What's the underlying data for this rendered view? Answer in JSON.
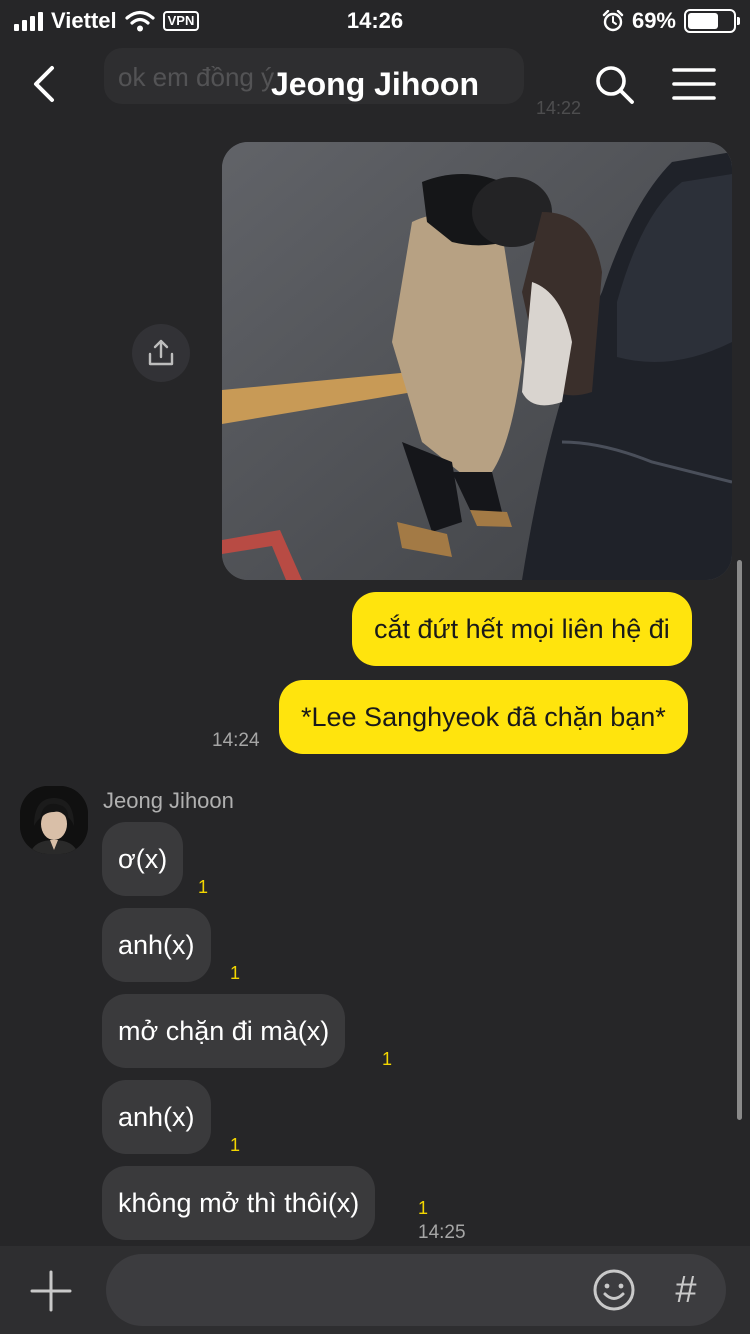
{
  "status_bar": {
    "carrier": "Viettel",
    "vpn": "VPN",
    "time": "14:26",
    "battery": "69%",
    "battery_level": 0.69,
    "icons": [
      "signal-icon",
      "wifi-icon",
      "alarm-icon",
      "battery-icon"
    ]
  },
  "header": {
    "title": "Jeong Jihoon",
    "ghost_message": "ok em đồng ý",
    "ghost_time": "14:22",
    "icons": [
      "back-icon",
      "search-icon",
      "menu-icon"
    ]
  },
  "messages": {
    "outgoing": [
      {
        "text": "cắt đứt hết mọi liên hệ đi"
      },
      {
        "text": "*Lee Sanghyeok đã chặn bạn*",
        "time": "14:24"
      }
    ],
    "sender_name": "Jeong Jihoon",
    "incoming": [
      {
        "text": "ơ(x)",
        "unread": "1"
      },
      {
        "text": "anh(x)",
        "unread": "1"
      },
      {
        "text": "mở chặn đi mà(x)",
        "unread": "1"
      },
      {
        "text": "anh(x)",
        "unread": "1"
      },
      {
        "text": "không mở thì thôi(x)",
        "unread": "1",
        "time": "14:25"
      }
    ]
  },
  "input_bar": {
    "value": "",
    "hash_label": "#",
    "icons": [
      "plus-icon",
      "emoji-icon",
      "hashtag-icon"
    ]
  },
  "colors": {
    "background": "#262628",
    "outgoing_bubble": "#ffe40d",
    "incoming_bubble": "#3a3a3c",
    "unread_count": "#f3d600"
  }
}
